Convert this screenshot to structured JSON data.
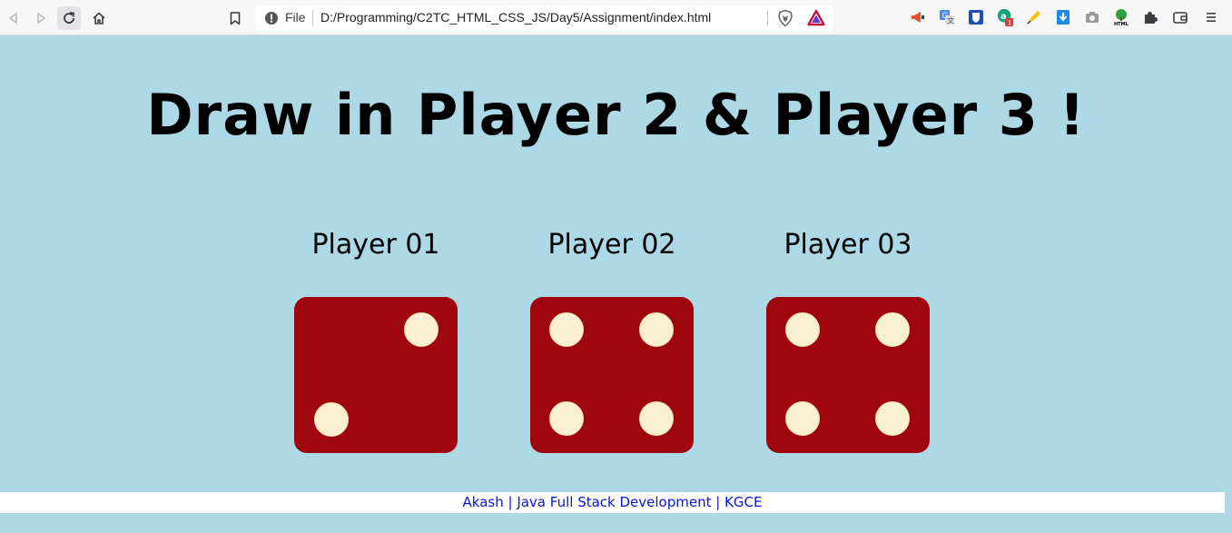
{
  "browser": {
    "url_scheme_label": "File",
    "url": "D:/Programming/C2TC_HTML_CSS_JS/Day5/Assignment/index.html",
    "icons": {
      "back": "back-arrow-icon",
      "forward": "forward-arrow-icon",
      "reload": "reload-icon",
      "home": "home-icon",
      "bookmark": "bookmark-icon",
      "info": "info-icon",
      "brave": "brave-shield-icon",
      "rewards": "brave-rewards-icon"
    },
    "extensions": [
      {
        "name": "megaphone-extension-icon",
        "badge": ""
      },
      {
        "name": "translate-extension-icon",
        "badge": ""
      },
      {
        "name": "bitwarden-extension-icon",
        "badge": ""
      },
      {
        "name": "grammarly-extension-icon",
        "badge": "1"
      },
      {
        "name": "highlighter-extension-icon",
        "badge": ""
      },
      {
        "name": "download-extension-icon",
        "badge": ""
      },
      {
        "name": "screenshot-extension-icon",
        "badge": ""
      },
      {
        "name": "html-tree-extension-icon",
        "badge": ""
      },
      {
        "name": "puzzle-extensions-icon",
        "badge": ""
      },
      {
        "name": "wallet-icon",
        "badge": ""
      },
      {
        "name": "menu-icon",
        "badge": ""
      }
    ]
  },
  "page": {
    "heading": "Draw in Player 2 & Player 3 !",
    "players": [
      {
        "label": "Player 01",
        "die_value": 2
      },
      {
        "label": "Player 02",
        "die_value": 4
      },
      {
        "label": "Player 03",
        "die_value": 4
      }
    ],
    "footer": "Akash | Java Full Stack Development | KGCE"
  },
  "colors": {
    "background": "#add8e6",
    "die": "#9e050c",
    "pip": "#faefd1",
    "footer_text": "#0a14d6"
  }
}
